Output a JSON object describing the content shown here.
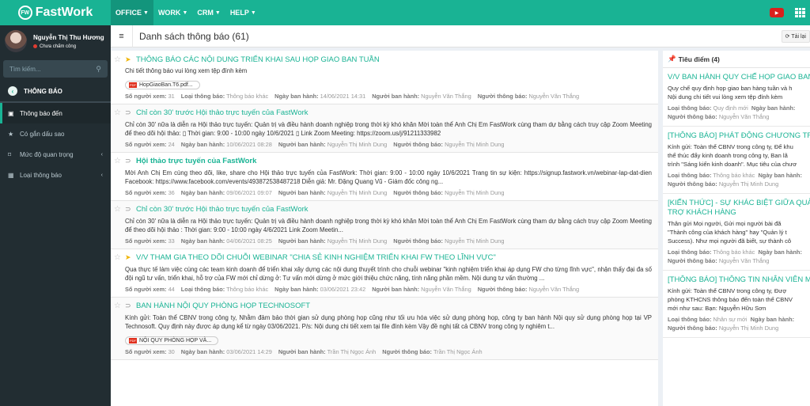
{
  "topbar": {
    "logo_mark": "FW",
    "logo_text": "FastWork",
    "nav": [
      {
        "label": "OFFICE",
        "active": true
      },
      {
        "label": "WORK",
        "active": false
      },
      {
        "label": "CRM",
        "active": false
      },
      {
        "label": "HELP",
        "active": false
      }
    ],
    "youtube_icon": "youtube-icon",
    "apps_icon": "apps-grid-icon"
  },
  "sidebar": {
    "user_name": "Nguyễn Thị Thu Hương",
    "user_status": "Chưa chấm công",
    "search_placeholder": "Tìm kiếm...",
    "section_title": "THÔNG BÁO",
    "menu": [
      {
        "label": "Thông báo đến",
        "icon": "inbox-icon",
        "active": true,
        "expandable": false
      },
      {
        "label": "Có gắn dấu sao",
        "icon": "star-icon",
        "active": false,
        "expandable": false
      },
      {
        "label": "Mức độ quan trọng",
        "icon": "bookmark-icon",
        "active": false,
        "expandable": true
      },
      {
        "label": "Loại thông báo",
        "icon": "grid-icon",
        "active": false,
        "expandable": true
      }
    ]
  },
  "header": {
    "title": "Danh sách thông báo (61)",
    "reload_label": "Tải lại"
  },
  "labels": {
    "views": "Số người xem:",
    "type": "Loại thông báo:",
    "issued_date": "Ngày ban hành:",
    "issuer": "Người ban hành:",
    "notifier": "Người thông báo:"
  },
  "notifications": [
    {
      "title": "THÔNG BÁO CÁC NỘI DUNG TRIỂN KHAI SAU HỌP GIAO BAN TUẦN",
      "important": true,
      "unread": false,
      "desc": "Chi tiết thông báo vui lòng xem tệp đính kèm",
      "attachment": "HopGiaoBan.T6.pdf...",
      "views": "31",
      "type": "Thông báo khác",
      "date": "14/06/2021 14:31",
      "issuer": "Nguyễn Văn Thắng",
      "notifier": "Nguyễn Văn Thắng"
    },
    {
      "title": "Chỉ còn 30' trước Hội thảo trực tuyến của FastWork",
      "important": false,
      "unread": false,
      "desc": "Chỉ còn 30' nữa là diễn ra Hội thảo trực tuyến: Quản trị và điều hành doanh nghiệp trong thời kỳ khó khăn Mời toàn thể Anh Chị Em FastWork cùng tham dự bằng cách truy cập Zoom Meeting để theo dõi hội thảo: ▯ Thời gian: 9:00 - 10:00 ngày 10/6/2021 ▯ Link Zoom Meeting: https://zoom.us/j/91211333982",
      "attachment": null,
      "views": "24",
      "type": null,
      "date": "10/06/2021 08:28",
      "issuer": "Nguyễn Thị Minh Dung",
      "notifier": "Nguyễn Thị Minh Dung"
    },
    {
      "title": "Hội thảo trực tuyến của FastWork",
      "important": false,
      "unread": true,
      "desc": "Mời Anh Chị Em cùng theo dõi, like, share cho Hội thảo trực tuyến của FastWork: Thời gian: 9:00 - 10:00 ngày 10/6/2021 Trang tin sự kiện: https://signup.fastwork.vn/webinar-lap-dat-dien Facebook: https://www.facebook.com/events/493872538487218 Diễn giả: Mr. Đặng Quang Vũ - Giám đốc công ng...",
      "attachment": null,
      "views": "36",
      "type": null,
      "date": "09/06/2021 09:07",
      "issuer": "Nguyễn Thị Minh Dung",
      "notifier": "Nguyễn Thị Minh Dung"
    },
    {
      "title": "Chỉ còn 30' trước Hội thảo trực tuyến của FastWork",
      "important": false,
      "unread": false,
      "desc": "Chỉ còn 30' nữa là diễn ra Hội thảo trực tuyến: Quản trị và điều hành doanh nghiệp trong thời kỳ khó khăn  Mời toàn thể Anh Chị Em FastWork cùng tham dự bằng cách truy cập Zoom Meeting để theo dõi hội thảo : Thời gian: 9:00 - 10:00 ngày 4/6/2021 Link Zoom Meetin...",
      "attachment": null,
      "views": "33",
      "type": null,
      "date": "04/06/2021 08:25",
      "issuer": "Nguyễn Thị Minh Dung",
      "notifier": "Nguyễn Thị Minh Dung"
    },
    {
      "title": "V/V THAM GIA THEO DÕI CHUỖI WEBINAR \"CHIA SẺ KINH NGHIỆM TRIỂN KHAI FW THEO LĨNH VỰC\"",
      "important": true,
      "unread": false,
      "desc": "Qua thực tế làm việc cùng các team kinh doanh để triển khai xây dựng các nội dung thuyết trình cho chuỗi webinar \"kinh nghiệm triển khai áp dụng FW cho từng lĩnh vực\", nhận thấy đại đa số đội ngũ tư vấn, triển khai, hỗ trợ của FW mới chỉ dừng ở: Tư vấn mới dừng ở mức giới thiệu chức năng, tính năng phần mềm. Nội dung tư vấn thường ...",
      "attachment": null,
      "views": "44",
      "type": "Thông báo khác",
      "date": "03/06/2021 23:42",
      "issuer": "Nguyễn Văn Thắng",
      "notifier": "Nguyễn Văn Thắng"
    },
    {
      "title": "BAN HÀNH NỘI QUY PHÒNG HỌP TECHNOSOFT",
      "important": false,
      "unread": false,
      "desc": "Kính gửi: Toàn thể CBNV trong công ty,  Nhằm đảm bảo thời gian sử dụng phòng họp cũng như tối ưu hóa việc sử dụng phòng họp, công ty ban hành Nội quy sử dụng phòng họp tại VP Technosoft.  Quy định này được áp dụng kể từ ngày 03/06/2021. P/s: Nội dung chi tiết xem tại file đính kèm   Vậy đề nghị tất cả CBNV trong công ty nghiêm t...",
      "attachment": "NỘI QUY PHÒNG HỌP VÀ...",
      "views": "30",
      "type": null,
      "date": "03/06/2021 14:29",
      "issuer": "Trần Thị Ngọc Ánh",
      "notifier": "Trần Thị Ngọc Ánh"
    }
  ],
  "highlights": {
    "title": "Tiêu điểm (4)",
    "items": [
      {
        "title": "V/V BAN HÀNH QUY CHẾ HỌP GIAO BAN",
        "desc": [
          "Quy chế quy định họp giao ban hàng tuần và h",
          "Nội dung chi tiết vui lòng xem tệp đính kèm"
        ],
        "type": "Quy định mới",
        "notifier": "Nguyễn Văn Thắng"
      },
      {
        "title": "[THÔNG BÁO] PHÁT ĐỘNG CHƯƠNG TRÌ",
        "desc": [
          "Kính gửi: Toàn thể CBNV trong công ty, Để khu",
          "thể thúc đẩy kinh doanh trong công ty, Ban lã",
          "trình \"Sáng kiến kinh doanh\". Mục tiêu của chươ"
        ],
        "type": "Thông báo khác",
        "notifier": "Nguyễn Thị Minh Dung"
      },
      {
        "title": "[KIẾN THỨC] - SỰ KHÁC BIỆT GIỮA QUẢ HÀNG VÀ HỖ TRỢ KHÁCH HÀNG",
        "desc": [
          "Thân gửi Mọi người,   Gửi mọi người bài đă",
          "\"Thành công của khách hàng\" hay \"Quản lý t",
          "Success).  Như mọi người đã biết, sự thành cô"
        ],
        "type": "Thông báo khác",
        "notifier": "Nguyễn Văn Thắng"
      },
      {
        "title": "[THÔNG BÁO] THÔNG TIN NHÂN VIÊN MỚ",
        "desc": [
          "Kính gửi: Toàn thể CBNV trong công ty, Đượ",
          "phòng KTHCNS thông báo đến toàn thể CBNV",
          "mới như sau:    Bạn: Nguyễn Hữu Sơn"
        ],
        "type": "Nhân sự mới",
        "notifier": "Nguyễn Thị Minh Dung"
      }
    ]
  }
}
